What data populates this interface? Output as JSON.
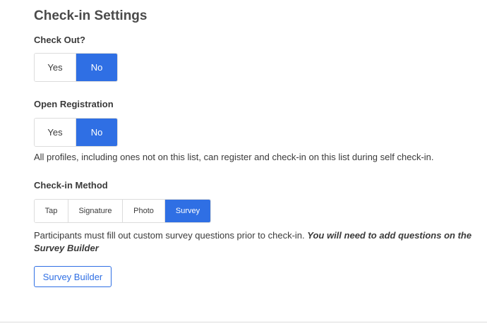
{
  "section": {
    "title": "Check-in Settings"
  },
  "check_out": {
    "label": "Check Out?",
    "options": [
      "Yes",
      "No"
    ],
    "selected": "No"
  },
  "open_registration": {
    "label": "Open Registration",
    "options": [
      "Yes",
      "No"
    ],
    "selected": "No",
    "description": "All profiles, including ones not on this list, can register and check-in on this list during self check-in."
  },
  "checkin_method": {
    "label": "Check-in Method",
    "options": [
      "Tap",
      "Signature",
      "Photo",
      "Survey"
    ],
    "selected": "Survey",
    "description": "Participants must fill out custom survey questions prior to check-in.",
    "description_emphasis": "You will need to add questions on the Survey Builder"
  },
  "survey_builder": {
    "button_label": "Survey Builder"
  },
  "colors": {
    "accent": "#2f6fe4",
    "text": "#3a3a3a",
    "border": "#dcdcdc"
  }
}
